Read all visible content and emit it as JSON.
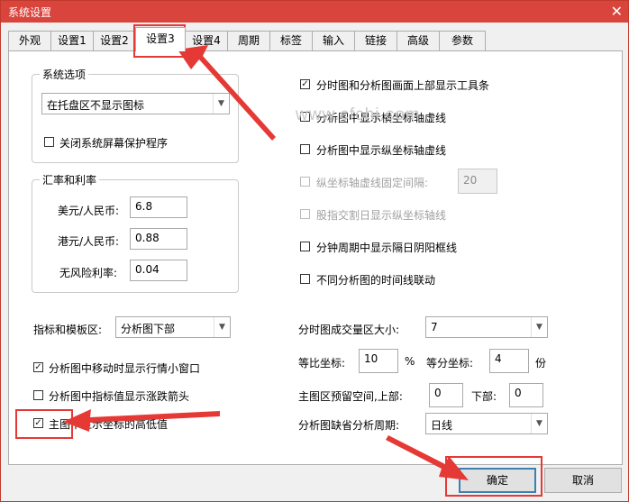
{
  "window": {
    "title": "系统设置",
    "close": "✕"
  },
  "tabs": [
    "外观",
    "设置1",
    "设置2",
    "设置3",
    "设置4",
    "周期",
    "标签",
    "输入",
    "链接",
    "高级",
    "参数"
  ],
  "left": {
    "system_options": {
      "title": "系统选项",
      "tray_select": "在托盘区不显示图标",
      "close_saver": {
        "label": "关闭系统屏幕保护程序",
        "checked": false
      }
    },
    "rates": {
      "title": "汇率和利率",
      "usd_label": "美元/人民币:",
      "usd_value": "6.8",
      "hkd_label": "港元/人民币:",
      "hkd_value": "0.88",
      "risk_label": "无风险利率:",
      "risk_value": "0.04"
    },
    "indicator": {
      "label": "指标和模板区:",
      "value": "分析图下部"
    },
    "move_window": {
      "label": "分析图中移动时显示行情小窗口",
      "checked": true
    },
    "arrow_show": {
      "label": "分析图中指标值显示涨跌箭头",
      "checked": false
    },
    "high_low": {
      "label": "主图中显示坐标的高低值",
      "checked": true
    }
  },
  "right": {
    "toolbar_top": {
      "label": "分时图和分析图画面上部显示工具条",
      "checked": true
    },
    "h_dash": {
      "label": "分析图中显示横坐标轴虚线",
      "checked": false
    },
    "v_dash": {
      "label": "分析图中显示纵坐标轴虚线",
      "checked": false
    },
    "fixed_interval": {
      "label": "纵坐标轴虚线固定间隔:",
      "value": "20",
      "checked": false
    },
    "ex_rights": {
      "label": "股指交割日显示纵坐标轴线",
      "checked": false
    },
    "yin_yang": {
      "label": "分钟周期中显示隔日阴阳框线",
      "checked": false
    },
    "time_link": {
      "label": "不同分析图的时间线联动",
      "checked": false
    },
    "volume_size": {
      "label": "分时图成交量区大小:",
      "value": "7"
    },
    "ratio_label": "等比坐标:",
    "ratio_value": "10",
    "ratio_unit": "%",
    "equal_label": "等分坐标:",
    "equal_value": "4",
    "equal_unit": "份",
    "reserve_label": "主图区预留空间,上部:",
    "reserve_top": "0",
    "bottom_label": "下部:",
    "reserve_bottom": "0",
    "period_label": "分析图缺省分析周期:",
    "period_value": "日线"
  },
  "buttons": {
    "ok": "确定",
    "cancel": "取消"
  },
  "watermark": "www.cfchi.com",
  "annotation_color": "#e53935"
}
